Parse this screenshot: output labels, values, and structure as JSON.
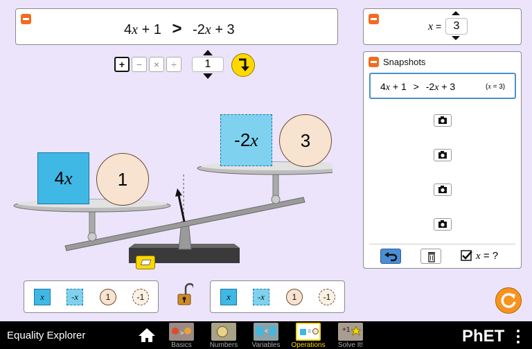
{
  "app": {
    "title": "Equality Explorer"
  },
  "equation": {
    "left_coef": "4",
    "left_var": "x",
    "left_rest": " + 1",
    "relation": ">",
    "right_coef": "-2",
    "right_var": "x",
    "right_rest": " + 3"
  },
  "operations": {
    "operators": [
      "+",
      "−",
      "×",
      "÷"
    ],
    "selected_operator": "+",
    "operand_value": "1"
  },
  "variable": {
    "label_var": "x",
    "label_eq": " =",
    "value": "3"
  },
  "snapshots": {
    "title": "Snapshots",
    "first": {
      "left_coef": "4",
      "left_var": "x",
      "left_rest": " + 1",
      "relation": ">",
      "right_coef": "-2",
      "right_var": "x",
      "right_rest": " + 3",
      "note_open": "(",
      "note_var": "x",
      "note_eq": " = 3)"
    },
    "empty_slot_count": 4,
    "show_value_label_var": "x",
    "show_value_label_rest": " = ?"
  },
  "scale": {
    "left_box_coef": "4",
    "left_box_var": "x",
    "left_circle": "1",
    "right_box_coef": "-2",
    "right_box_var": "x",
    "right_circle": "3"
  },
  "toolboxes": {
    "left": {
      "x": "x",
      "neg_x": "-x",
      "one": "1",
      "neg_one": "-1"
    },
    "right": {
      "x": "x",
      "neg_x": "-x",
      "one": "1",
      "neg_one": "-1"
    }
  },
  "nav": {
    "screens": [
      {
        "label": "Basics"
      },
      {
        "label": "Numbers"
      },
      {
        "label": "Variables"
      },
      {
        "label": "Operations"
      },
      {
        "label": "Solve It!"
      }
    ],
    "selected": "Operations",
    "brand": "PhET"
  },
  "colors": {
    "accent_orange": "#f26b22",
    "term_blue": "#3fb8e6",
    "term_circle": "#f7e3d0",
    "background": "#ece4fa",
    "nav_selected": "#ffd800"
  }
}
